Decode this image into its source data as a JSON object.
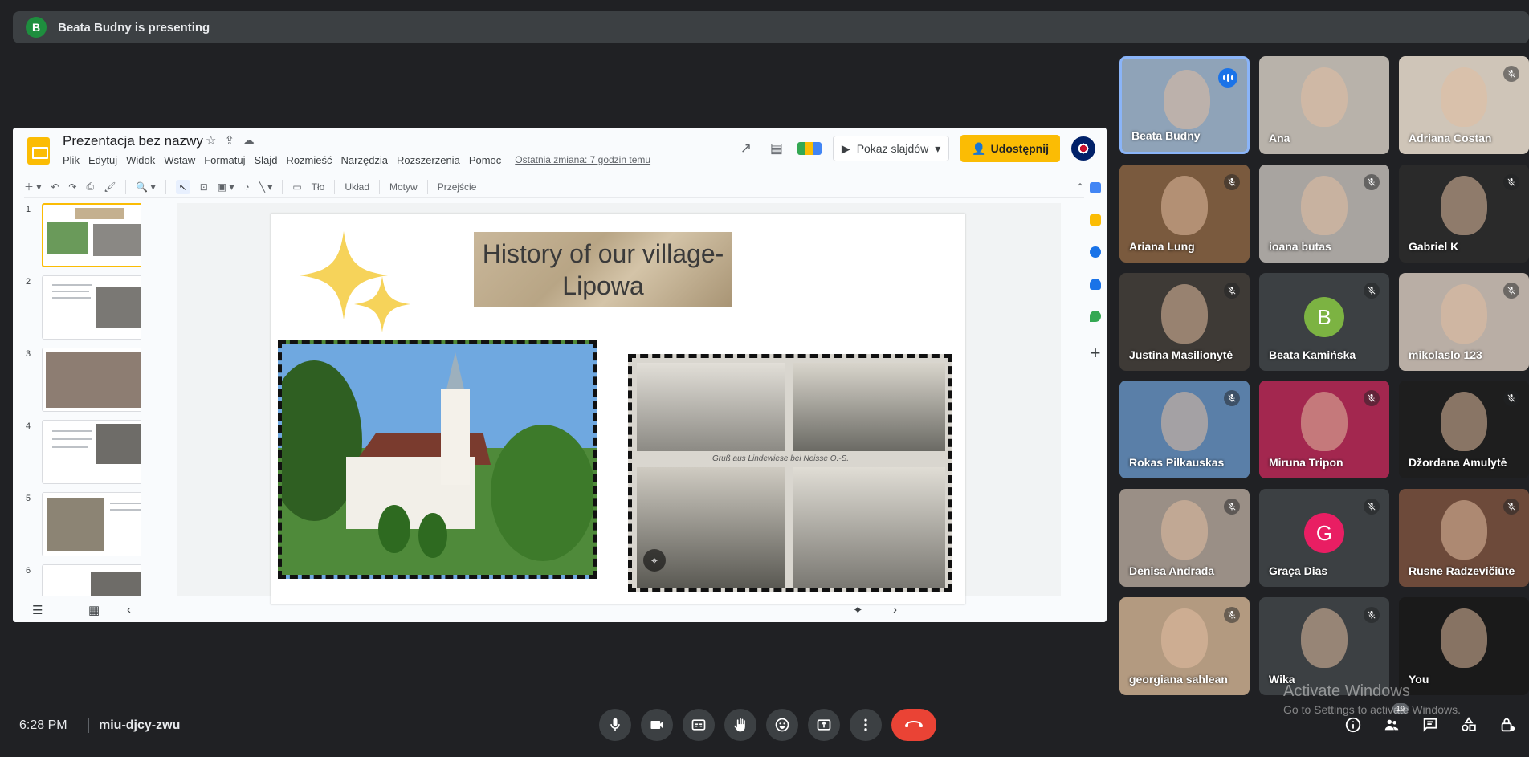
{
  "presenting": {
    "avatar_letter": "B",
    "text": "Beata Budny is presenting"
  },
  "slides_doc": {
    "title": "Prezentacja bez nazwy",
    "menu": [
      "Plik",
      "Edytuj",
      "Widok",
      "Wstaw",
      "Formatuj",
      "Slajd",
      "Rozmieść",
      "Narzędzia",
      "Rozszerzenia",
      "Pomoc"
    ],
    "last_edit": "Ostatnia zmiana: 7 godzin temu",
    "slideshow_label": "Pokaz slajdów",
    "share_label": "Udostępnij",
    "toolbar": {
      "background": "Tło",
      "layout": "Układ",
      "theme": "Motyw",
      "transition": "Przejście"
    },
    "slide_numbers": [
      "1",
      "2",
      "3",
      "4",
      "5",
      "6"
    ],
    "current_slide": {
      "title_line1": "History of our village-",
      "title_line2": "Lipowa",
      "postcard_caption": "Gruß aus Lindewiese bei Neisse O.-S."
    }
  },
  "participants": [
    {
      "name": "Beata Budny",
      "muted": false,
      "speaking": true,
      "bg": "#8fa3b8"
    },
    {
      "name": "Ana",
      "muted": false,
      "speaking": false,
      "bg": "#b8b2aa"
    },
    {
      "name": "Adriana Costan",
      "muted": true,
      "speaking": false,
      "bg": "#cfc5b8"
    },
    {
      "name": "Ariana Lung",
      "muted": true,
      "speaking": false,
      "bg": "#7a5a3e"
    },
    {
      "name": "ioana butas",
      "muted": true,
      "speaking": false,
      "bg": "#a8a4a0"
    },
    {
      "name": "Gabriel K",
      "muted": true,
      "speaking": false,
      "bg": "#2a2a2a"
    },
    {
      "name": "Justina Masilionytė",
      "muted": true,
      "speaking": false,
      "bg": "#3e3a36"
    },
    {
      "name": "Beata Kamińska",
      "muted": true,
      "speaking": false,
      "avatar": "B",
      "avatar_color": "#7cb342"
    },
    {
      "name": "mikolaslo 123",
      "muted": true,
      "speaking": false,
      "bg": "#b9aea5"
    },
    {
      "name": "Rokas Pilkauskas",
      "muted": true,
      "speaking": false,
      "bg": "#5a7fa8"
    },
    {
      "name": "Miruna Tripon",
      "muted": true,
      "speaking": false,
      "bg": "#a3274f"
    },
    {
      "name": "Džordana Amulytė",
      "muted": true,
      "speaking": false,
      "bg": "#1e1e1e"
    },
    {
      "name": "Denisa Andrada",
      "muted": true,
      "speaking": false,
      "bg": "#9a8f86"
    },
    {
      "name": "Graça Dias",
      "muted": true,
      "speaking": false,
      "avatar": "G",
      "avatar_color": "#e91e63"
    },
    {
      "name": "Rusne Radzevičiūte",
      "muted": true,
      "speaking": false,
      "bg": "#6d4a3a"
    },
    {
      "name": "georgiana sahlean",
      "muted": true,
      "speaking": false,
      "bg": "#b39a80"
    },
    {
      "name": "Wika",
      "muted": true,
      "speaking": false,
      "bg": "#3c4043"
    },
    {
      "name": "You",
      "muted": false,
      "speaking": false,
      "bg": "#1a1a1a"
    }
  ],
  "bottom": {
    "time": "6:28 PM",
    "meeting_code": "miu-djcy-zwu",
    "people_count": "19"
  },
  "watermark": {
    "line1": "Activate Windows",
    "line2": "Go to Settings to activate Windows."
  },
  "colors": {
    "hangup": "#ea4335",
    "share": "#fbbc04",
    "speaking_border": "#8ab4f8"
  }
}
